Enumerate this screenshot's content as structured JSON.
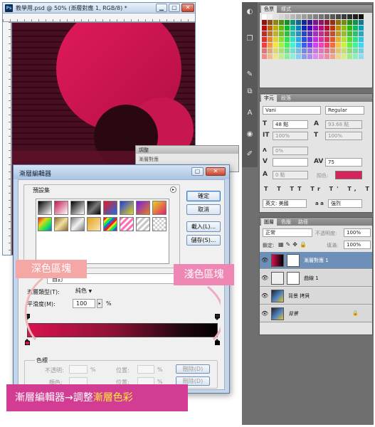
{
  "document": {
    "title": "教學用.psd @ 50% (漸層對應 1, RGB/8) *",
    "ps_label": "Ps"
  },
  "adjustments": {
    "title": "調整",
    "subtitle": "漸層對應"
  },
  "gradient_editor": {
    "title": "漸層編輯器",
    "presets_label": "預設集",
    "buttons": {
      "ok": "確定",
      "cancel": "取消",
      "load": "載入(L)...",
      "save": "儲存(S)..."
    },
    "name_value": "自訂",
    "gradient_type_label": "漸層類型(T):",
    "gradient_type_value": "純色",
    "smoothness_label": "平滑度(M):",
    "smoothness_value": "100",
    "smoothness_unit": "%",
    "stops": {
      "group_label": "色標",
      "opacity_label": "不透明:",
      "location_label": "位置:",
      "color_label": "顏色:",
      "percent": "%",
      "delete_label": "刪除(D)"
    },
    "gradient_colors": [
      "#d9124e",
      "#8e1237",
      "#240710",
      "#000000"
    ]
  },
  "swatches_panel": {
    "tabs": [
      "色票",
      "樣式"
    ]
  },
  "character_panel": {
    "tabs": [
      "字元",
      "段落"
    ],
    "font_family": "Vani",
    "font_style": "Regular",
    "font_size": "48 點",
    "leading": "93.68 點",
    "vertical_scale": "100%",
    "horizontal_scale": "100%",
    "tsume": "0%",
    "tracking": "75",
    "baseline_shift": "0 點",
    "color_label": "顏色:",
    "color_value": "#d6245a",
    "language": "英文: 美國",
    "antialias": "強烈",
    "aa_label": "a a"
  },
  "layers_panel": {
    "tabs": [
      "圖層",
      "色版",
      "路徑"
    ],
    "blend_mode": "正常",
    "opacity_label": "不透明度:",
    "opacity_value": "100%",
    "lock_label": "鎖定:",
    "fill_label": "填滿:",
    "fill_value": "100%",
    "layers": [
      {
        "name": "漸層對應 1",
        "selected": true
      },
      {
        "name": "曲線 1",
        "selected": false
      },
      {
        "name": "背景 拷貝",
        "selected": false
      },
      {
        "name": "背景",
        "selected": false
      }
    ]
  },
  "annotations": {
    "dark_block": "深色區塊",
    "light_block": "淺色區塊",
    "caption_main": "漸層編輯器→調整",
    "caption_highlight": "漸層色彩"
  }
}
